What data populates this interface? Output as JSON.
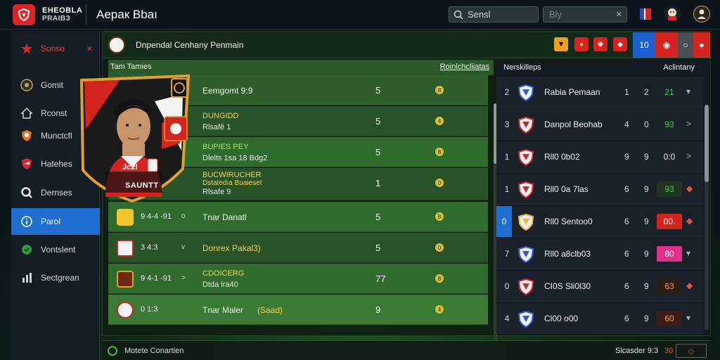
{
  "topbar": {
    "brand_line1": "ЕНЕОВLА",
    "brand_line2": "РRАIВЗ",
    "title": "Аерак Bbaı",
    "search_label": "Sensl",
    "filter_label": "Bly"
  },
  "sidebar": {
    "items": [
      {
        "label": "Sonso",
        "icon": "star-icon",
        "active": false
      },
      {
        "label": "Gomit",
        "icon": "crest-icon",
        "active": false
      },
      {
        "label": "Rconst",
        "icon": "home-icon",
        "active": false
      },
      {
        "label": "Munctcfl",
        "icon": "shield-icon",
        "active": false
      },
      {
        "label": "Hatehes",
        "icon": "badge-icon",
        "active": false
      },
      {
        "label": "Dernses",
        "icon": "q-icon",
        "active": false
      },
      {
        "label": "Parol",
        "icon": "info-icon",
        "active": true
      },
      {
        "label": "Vontslent",
        "icon": "circle-icon",
        "active": false
      },
      {
        "label": "Sectgrean",
        "icon": "chart-icon",
        "active": false
      }
    ]
  },
  "main": {
    "title": "Dnpendal Cenhany Penmain",
    "blocks": [
      "10",
      "",
      ""
    ]
  },
  "left_table": {
    "header_left": "Tam Tamies",
    "header_right": "Roinlchcliiatas",
    "rows": [
      {
        "line1": "Eemgomt 9:9",
        "line2": "",
        "num": "5",
        "dot": "8"
      },
      {
        "line1": "DUNGIDD",
        "line2": "Rlsafê 1",
        "num": "5",
        "dot": "4"
      },
      {
        "line1": "BUPIES PEY",
        "line2": "Dlelts 1sa 18 Bdg2",
        "num": "5",
        "dot": "8"
      },
      {
        "line1": "BUCWIRUCHER",
        "line2": "Dstatedıa Buaieset",
        "line3": "Rlsafe 9",
        "num": "1",
        "dot": "0"
      },
      {
        "small": "9 4-4 -91",
        "arrow": "o",
        "line1": "Tnar Danatl",
        "num": "5",
        "dot": "8"
      },
      {
        "small": "3 4:3",
        "arrow": "v",
        "line1": "Donrex Pakal3)",
        "num": "5",
        "dot": "0"
      },
      {
        "small": "9 4-1 -91",
        "arrow": ">",
        "line1": "CDOICERG",
        "line2": "Dtda lra40",
        "num": "77",
        "dot": "8"
      },
      {
        "small": "0 1:3",
        "arrow": "",
        "line1": "Tnar Maler",
        "line1b": "(Saad)",
        "num": "9",
        "dot": "4"
      }
    ]
  },
  "player_card": {
    "name_tag": "Jc2l",
    "banner": "SAUNTT"
  },
  "right_table": {
    "header_left": "Nerskilleps",
    "header_right": "Aclintany",
    "rows": [
      {
        "rank": "2",
        "name": "Rabia Pemaan",
        "c1": "1",
        "c2": "2",
        "pts": "21",
        "pts_color": "#3fcf3f",
        "pts_bg": "",
        "act": "▾",
        "crest": "#2f5bd1",
        "sel": false
      },
      {
        "rank": "3",
        "name": "Danpol Beohab",
        "c1": "4",
        "c2": "0",
        "pts": "93",
        "pts_color": "#3fcf3f",
        "pts_bg": "",
        "act": ">",
        "crest": "#c42a2a",
        "sel": false
      },
      {
        "rank": "1",
        "name": "Rll0 0b02",
        "c1": "9",
        "c2": "9",
        "pts": "0:0",
        "pts_color": "#e8e8e8",
        "pts_bg": "",
        "act": ">",
        "crest": "#d0262c",
        "sel": false
      },
      {
        "rank": "1",
        "name": "Rll0 0a 7las",
        "c1": "6",
        "c2": "9",
        "pts": "93",
        "pts_color": "#3fcf3f",
        "pts_bg": "#1f3324",
        "act": "◆",
        "crest": "#d0262c",
        "sel": false
      },
      {
        "rank": "0",
        "name": "Rll0 Sentoo0",
        "c1": "6",
        "c2": "9",
        "pts": "00.",
        "pts_color": "#ffffff",
        "pts_bg": "#d3241f",
        "act": "◆",
        "crest": "#f4b52a",
        "sel": true
      },
      {
        "rank": "7",
        "name": "Rll0 a8clb03",
        "c1": "6",
        "c2": "9",
        "pts": "80",
        "pts_color": "#ffffff",
        "pts_bg": "#e0308a",
        "act": "▾",
        "crest": "#2f5bd1",
        "sel": false
      },
      {
        "rank": "0",
        "name": "CI0S Sli0l30",
        "c1": "6",
        "c2": "9",
        "pts": "63",
        "pts_color": "#f0a030",
        "pts_bg": "#2a1a18",
        "act": "◆",
        "crest": "#d0262c",
        "sel": false
      },
      {
        "rank": "4",
        "name": "Cl00 o00",
        "c1": "6",
        "c2": "9",
        "pts": "60",
        "pts_color": "#f0a030",
        "pts_bg": "#3a1e18",
        "act": "▾",
        "crest": "#2f5bd1",
        "sel": false
      }
    ]
  },
  "footer": {
    "left": "Motete Conartien",
    "right": "Slcasder 9:3",
    "right2": "30"
  },
  "colors": {
    "accent_blue": "#1e6fd0",
    "brand_red": "#d9262c",
    "row_green": "#2e6b2c",
    "dot_yellow": "#d8c13a"
  }
}
